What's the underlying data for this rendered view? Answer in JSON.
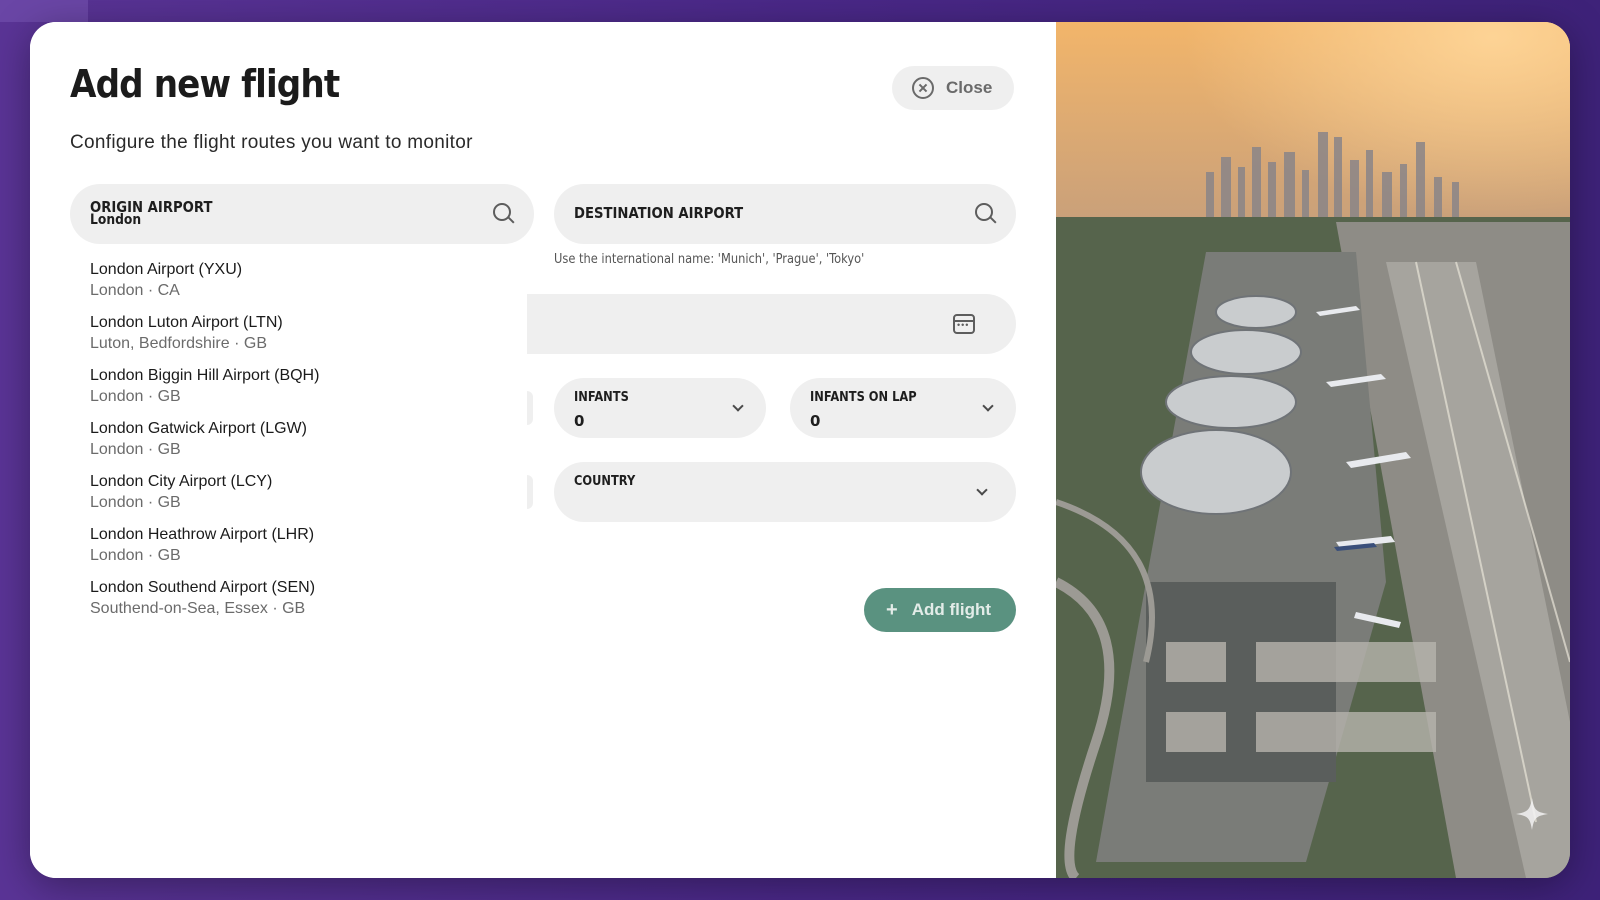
{
  "modal": {
    "title": "Add new flight",
    "subtitle": "Configure the flight routes you want to monitor",
    "close_label": "Close"
  },
  "origin": {
    "label": "ORIGIN AIRPORT",
    "value": "London"
  },
  "destination": {
    "label": "DESTINATION AIRPORT",
    "hint": "Use the international name: 'Munich', 'Prague', 'Tokyo'"
  },
  "selects": {
    "infants": {
      "label": "INFANTS",
      "value": "0"
    },
    "infants_on_lap": {
      "label": "INFANTS ON LAP",
      "value": "0"
    },
    "country": {
      "label": "COUNTRY",
      "value": ""
    }
  },
  "suggestions": [
    {
      "name": "London Airport (YXU)",
      "place": "London · CA"
    },
    {
      "name": "London Luton Airport (LTN)",
      "place": "Luton, Bedfordshire · GB"
    },
    {
      "name": "London Biggin Hill Airport (BQH)",
      "place": "London · GB"
    },
    {
      "name": "London Gatwick Airport (LGW)",
      "place": "London · GB"
    },
    {
      "name": "London City Airport (LCY)",
      "place": "London · GB"
    },
    {
      "name": "London Heathrow Airport (LHR)",
      "place": "London · GB"
    },
    {
      "name": "London Southend Airport (SEN)",
      "place": "Southend-on-Sea, Essex · GB"
    }
  ],
  "actions": {
    "add_flight_label": "Add flight"
  },
  "icons": {
    "close": "close-circle-icon",
    "search": "search-icon",
    "calendar": "calendar-icon",
    "chevron": "chevron-down-icon",
    "plus": "plus-icon",
    "sparkle": "sparkle-icon"
  },
  "colors": {
    "backdrop": "#4b2a8a",
    "primary_button": "#3e7f6b",
    "field_bg": "#efefef"
  }
}
